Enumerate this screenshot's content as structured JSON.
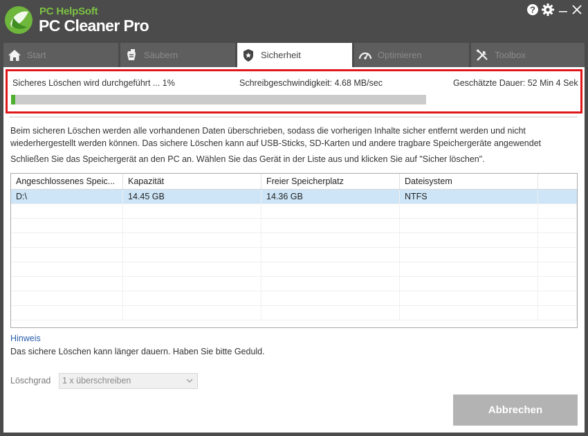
{
  "app": {
    "brand_top": "PC HelpSoft",
    "brand_main": "PC Cleaner Pro",
    "help_icon": "help-icon",
    "settings_icon": "gear-icon",
    "minimize_label": "—",
    "close_label": "✕"
  },
  "tabs": [
    {
      "label": "Start",
      "icon": "home-icon",
      "active": false
    },
    {
      "label": "Säubern",
      "icon": "clean-icon",
      "active": false
    },
    {
      "label": "Sicherheit",
      "icon": "shield-icon",
      "active": true
    },
    {
      "label": "Optimieren",
      "icon": "gauge-icon",
      "active": false
    },
    {
      "label": "Toolbox",
      "icon": "tools-icon",
      "active": false
    }
  ],
  "status": {
    "progress_text": "Sicheres Löschen wird durchgeführt ... 1%",
    "speed_text": "Schreibgeschwindigkeit: 4.68 MB/sec",
    "duration_text": "Geschätzte Dauer: 52 Min 4 Sek",
    "progress_percent": 1,
    "accent_color": "#e0161b",
    "progress_color": "#4db02f"
  },
  "description": "Beim sicheren Löschen werden alle vorhandenen Daten überschrieben, sodass die vorherigen Inhalte sicher entfernt werden und nicht wiederhergestellt werden können. Das sichere Löschen kann auf USB-Sticks, SD-Karten und andere tragbare Speichergeräte angewendet",
  "instruction": "Schließen Sie das Speichergerät an den PC an. Wählen Sie das Gerät in der Liste aus und klicken Sie auf \"Sicher löschen\".",
  "table": {
    "columns": [
      "Angeschlossenes Speic...",
      "Kapazität",
      "Freier Speicherplatz",
      "Dateisystem"
    ],
    "rows": [
      [
        "D:\\",
        "14.45 GB",
        "14.36 GB",
        "NTFS"
      ]
    ]
  },
  "hint": {
    "title": "Hinweis",
    "text": "Das sichere Löschen kann länger dauern. Haben Sie bitte Geduld."
  },
  "wipe": {
    "label": "Löschgrad",
    "selected": "1 x überschreiben"
  },
  "cancel_label": "Abbrechen"
}
